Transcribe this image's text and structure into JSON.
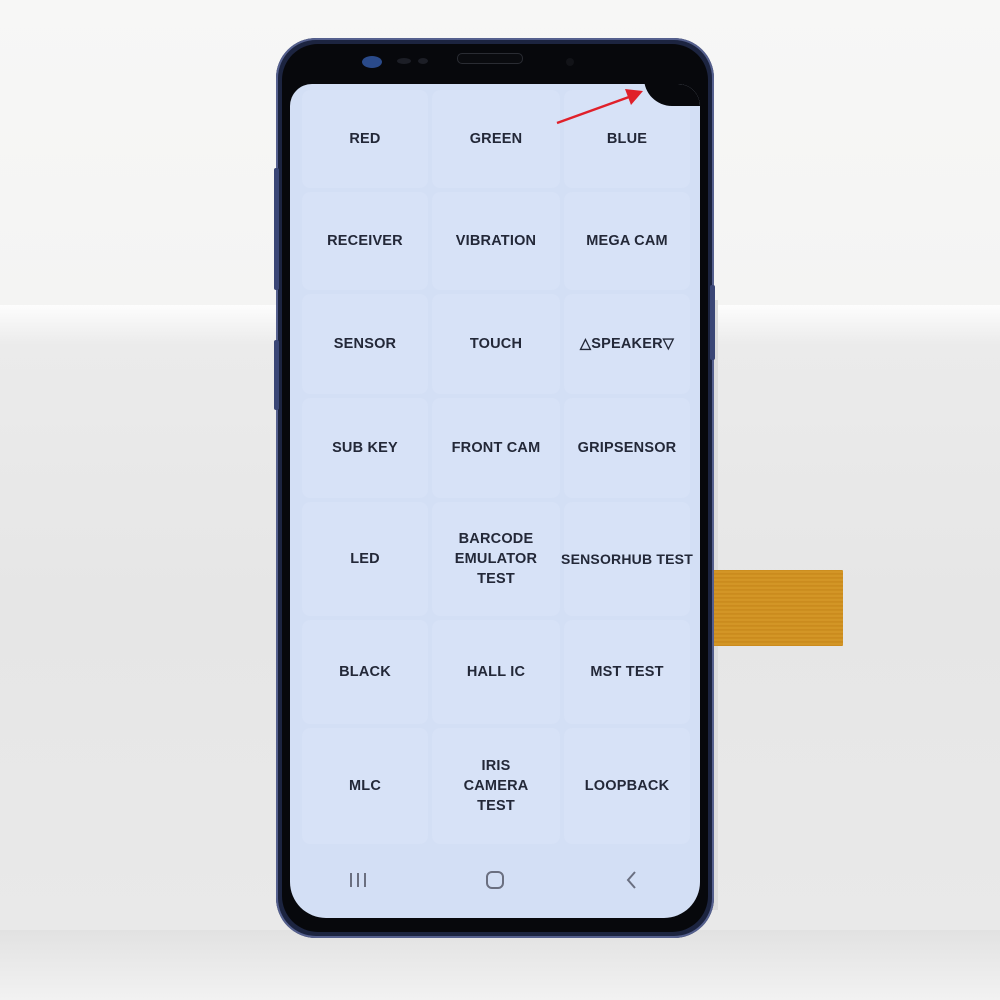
{
  "screen": {
    "background_color": "#d3dff5",
    "text_color": "#232838",
    "test_menu": [
      {
        "label": "RED"
      },
      {
        "label": "GREEN"
      },
      {
        "label": "BLUE"
      },
      {
        "label": "RECEIVER"
      },
      {
        "label": "VIBRATION"
      },
      {
        "label": "MEGA CAM"
      },
      {
        "label": "SENSOR"
      },
      {
        "label": "TOUCH"
      },
      {
        "label": "△SPEAKER▽"
      },
      {
        "label": "SUB KEY"
      },
      {
        "label": "FRONT CAM"
      },
      {
        "label": "GRIPSENSOR"
      },
      {
        "label": "LED"
      },
      {
        "label": "BARCODE EMULATOR TEST"
      },
      {
        "label": "SENSORHUB TEST"
      },
      {
        "label": "BLACK"
      },
      {
        "label": "HALL IC"
      },
      {
        "label": "MST TEST"
      },
      {
        "label": "MLC"
      },
      {
        "label": "IRIS CAMERA TEST"
      },
      {
        "label": "LOOPBACK"
      }
    ],
    "nav_bar": [
      {
        "icon": "recent-apps-icon"
      },
      {
        "icon": "home-icon"
      },
      {
        "icon": "back-icon"
      }
    ]
  },
  "annotation": {
    "type": "arrow",
    "color": "#e0202a",
    "points_to": "black corner defect top-right of screen"
  },
  "device": {
    "frame_color": "#1c2440",
    "flex_cable_color": "#c98a1c"
  }
}
